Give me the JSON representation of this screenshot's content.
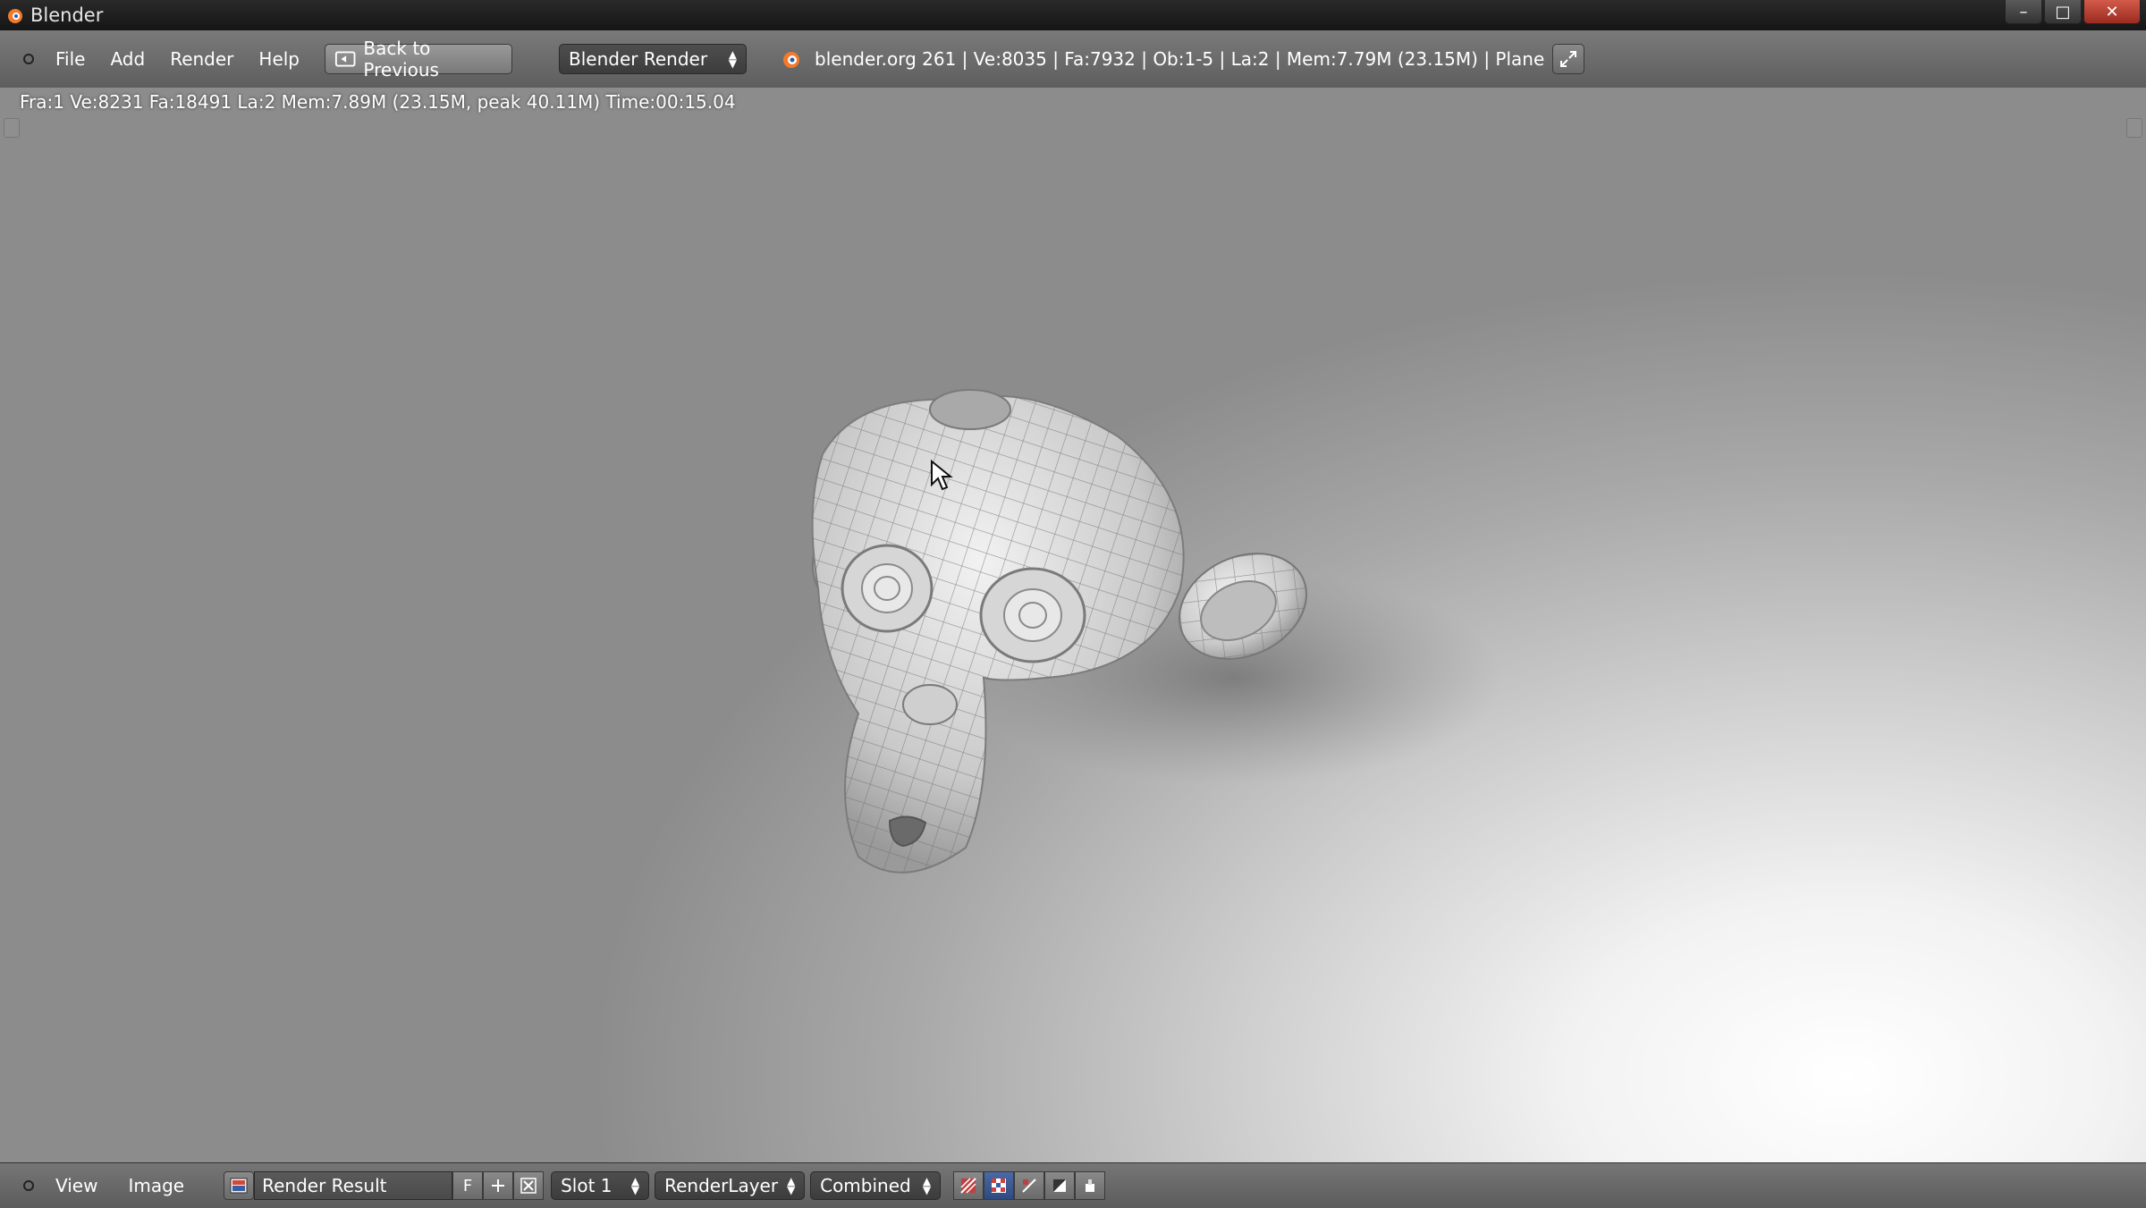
{
  "window": {
    "title": "Blender",
    "minimize": "–",
    "maximize": "□",
    "close": "✕"
  },
  "header": {
    "menus": [
      "File",
      "Add",
      "Render",
      "Help"
    ],
    "back_label": "Back to Previous",
    "engine": "Blender Render",
    "info": "blender.org 261 | Ve:8035 | Fa:7932 | Ob:1-5 | La:2 | Mem:7.79M (23.15M) | Plane"
  },
  "viewport": {
    "stats": "Fra:1  Ve:8231 Fa:18491 La:2 Mem:7.89M (23.15M, peak 40.11M) Time:00:15.04"
  },
  "footer": {
    "menus": [
      "View",
      "Image"
    ],
    "image_name": "Render Result",
    "fake_user": "F",
    "slot": "Slot 1",
    "layer": "RenderLayer",
    "pass": "Combined"
  },
  "icons": {
    "editor": "editor-type-icon",
    "back": "back-icon",
    "logo": "blender-logo-icon",
    "fullscreen": "fullscreen-icon",
    "image": "image-icon",
    "new": "plus-icon",
    "unlink": "x-icon",
    "draw_modes": [
      "color-alpha-icon",
      "checker-icon",
      "zbuffer-icon",
      "alpha-icon",
      "paint-icon"
    ]
  },
  "colors": {
    "selected": "#3d5f9f",
    "close_button": "#c0392b",
    "logo_orange": "#f5792a"
  }
}
